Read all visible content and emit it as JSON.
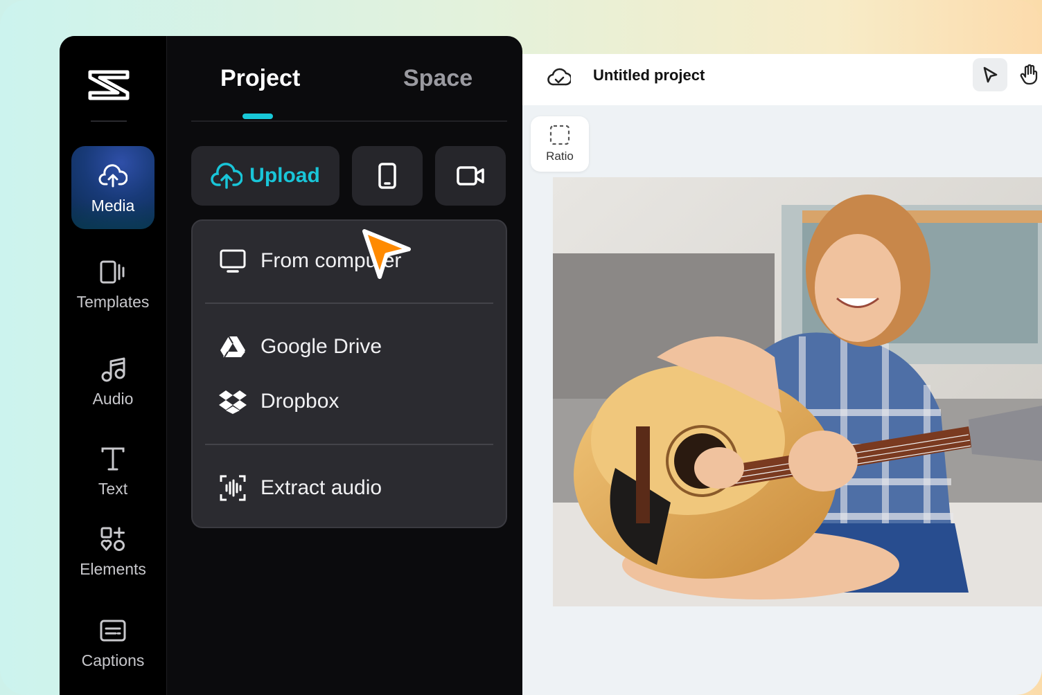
{
  "sidebar": {
    "items": [
      {
        "label": "Media",
        "icon": "cloud-upload-icon",
        "active": true
      },
      {
        "label": "Templates",
        "icon": "templates-icon"
      },
      {
        "label": "Audio",
        "icon": "music-note-icon"
      },
      {
        "label": "Text",
        "icon": "text-icon"
      },
      {
        "label": "Elements",
        "icon": "elements-icon"
      },
      {
        "label": "Captions",
        "icon": "captions-icon"
      }
    ]
  },
  "tabs": {
    "project": "Project",
    "space": "Space"
  },
  "toolbar": {
    "upload_label": "Upload"
  },
  "upload_menu": {
    "from_computer": "From computer",
    "google_drive": "Google Drive",
    "dropbox": "Dropbox",
    "extract_audio": "Extract audio"
  },
  "header": {
    "title": "Untitled project"
  },
  "canvas": {
    "ratio_label": "Ratio"
  },
  "colors": {
    "accent": "#19c5d8",
    "cursor": "#ff8a00",
    "panel_bg": "#0b0b0d"
  }
}
